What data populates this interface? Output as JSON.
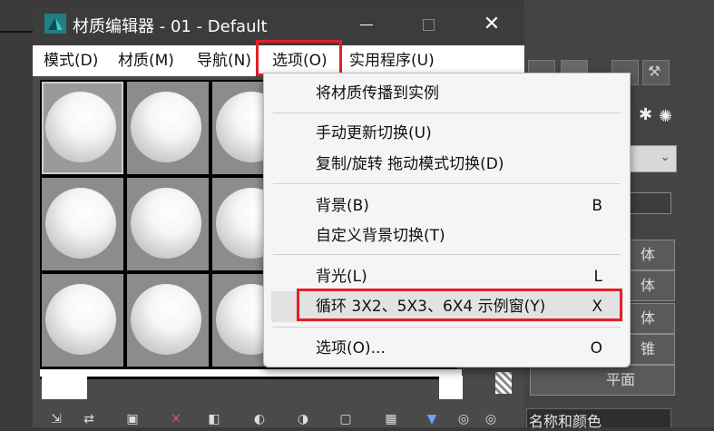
{
  "window": {
    "title": "材质编辑器 - 01 - Default",
    "controls": {
      "minimize": "minimize",
      "maximize": "maximize",
      "close": "✕"
    }
  },
  "menubar": {
    "items": [
      {
        "label": "模式(D)"
      },
      {
        "label": "材质(M)"
      },
      {
        "label": "导航(N)"
      },
      {
        "label": "选项(O)"
      },
      {
        "label": "实用程序(U)"
      }
    ],
    "highlight_color": "#e0202b"
  },
  "dropdown": {
    "items": [
      {
        "label": "将材质传播到实例",
        "shortcut": ""
      },
      {
        "label": "手动更新切换(U)",
        "shortcut": ""
      },
      {
        "label": "复制/旋转 拖动模式切换(D)",
        "shortcut": ""
      },
      {
        "label": "背景(B)",
        "shortcut": "B"
      },
      {
        "label": "自定义背景切换(T)",
        "shortcut": ""
      },
      {
        "label": "背光(L)",
        "shortcut": "L"
      },
      {
        "label": "循环 3X2、5X3、6X4 示例窗(Y)",
        "shortcut": "X"
      },
      {
        "label": "选项(O)...",
        "shortcut": "O"
      }
    ]
  },
  "right_panel": {
    "labels": [
      "体",
      "体",
      "体",
      "锥",
      "平面"
    ],
    "caption": "名称和颜色"
  },
  "icons": [
    "app-3ds-icon",
    "wrench-hammer-icon",
    "teapot-icon",
    "sample-slot-icon"
  ]
}
